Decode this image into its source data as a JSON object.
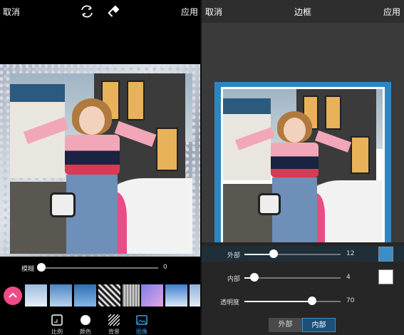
{
  "left": {
    "topbar": {
      "cancel": "取消",
      "apply": "应用",
      "icons": [
        "swap-icon",
        "eraser-icon"
      ]
    },
    "blur": {
      "label": "模糊",
      "value": "0",
      "level": 0
    },
    "thumbnails": [
      "thumb-sky",
      "thumb-clouds-1",
      "thumb-clouds-2",
      "thumb-texture-bw",
      "thumb-gray",
      "thumb-purple-gradient",
      "thumb-blue-sky",
      "thumb-clouds-3"
    ],
    "tabs": [
      {
        "label": "比例",
        "icon": "aspect-ratio-icon"
      },
      {
        "label": "颜色",
        "icon": "color-circle-icon"
      },
      {
        "label": "背景",
        "icon": "background-pattern-icon"
      },
      {
        "label": "图像",
        "icon": "image-icon",
        "active": true
      }
    ],
    "accent": "#ef4b86"
  },
  "right": {
    "topbar": {
      "cancel": "取消",
      "title": "边框",
      "apply": "应用"
    },
    "sliders": [
      {
        "label": "外部",
        "value": "12",
        "level": 0.3
      },
      {
        "label": "内部",
        "value": "4",
        "level": 0.1
      },
      {
        "label": "透明度",
        "value": "70",
        "level": 0.7
      }
    ],
    "swatches": {
      "outer": "#3a8fc8",
      "inner": "#ffffff"
    },
    "segments": [
      {
        "label": "外部",
        "active": false
      },
      {
        "label": "内部",
        "active": true
      }
    ],
    "frame_color": "#2e86c1"
  }
}
